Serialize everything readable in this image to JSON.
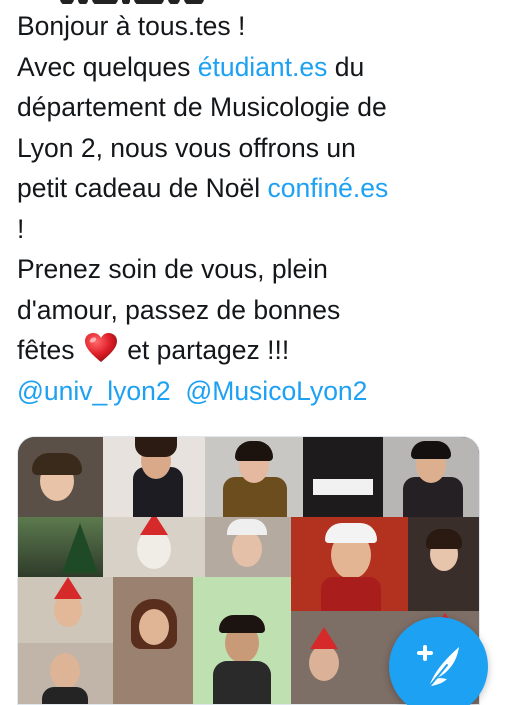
{
  "tweet": {
    "line1": "Bonjour à tous.tes !",
    "line2_prefix": "Avec quelques ",
    "line2_link": "étudiant.es",
    "line2_suffix": " du",
    "line3": "département de Musicologie de",
    "line4": "Lyon 2, nous vous offrons un",
    "line5_prefix": "petit cadeau de Noël ",
    "line5_link": "confiné.es",
    "line6": "!",
    "line7": "Prenez soin de vous, plein",
    "line8": "d'amour, passez de bonnes",
    "line9_prefix": "fêtes ",
    "line9_suffix": " et partagez !!!",
    "mention1": "@univ_lyon2",
    "mention2": "@MusicoLyon2"
  },
  "colors": {
    "link": "#1da1f2",
    "text": "#14171a",
    "fab": "#1da1f2",
    "heart": "#e0202a"
  },
  "media": {
    "kind": "video-collage-thumbnail",
    "tiles": 18
  },
  "compose_button": {
    "icon": "compose-feather-plus-icon"
  }
}
